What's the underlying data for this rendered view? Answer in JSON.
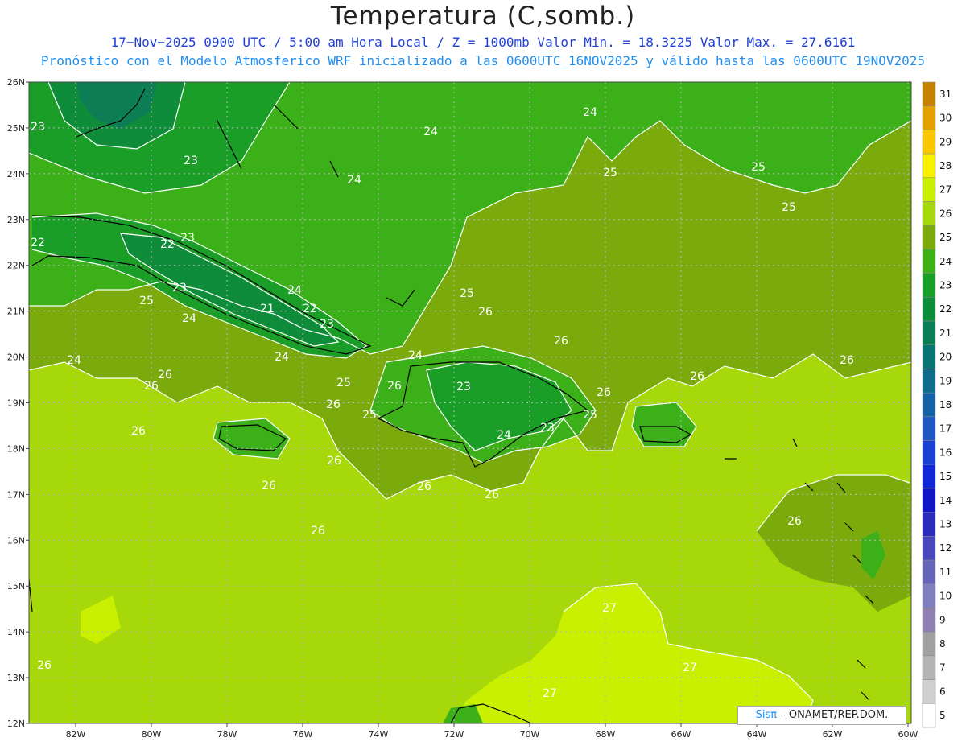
{
  "header": {
    "title": "Temperatura (C,somb.)",
    "line1": "17−Nov−2025  0900 UTC / 5:00 am Hora Local / Z = 1000mb   Valor Min. = 18.3225  Valor Max. = 27.6161",
    "line2": "Pronóstico con el Modelo Atmosferico WRF inicializado a las 0600UTC_16NOV2025 y válido hasta las  0600UTC_19NOV2025"
  },
  "axes": {
    "lat_labels": [
      "26N",
      "25N",
      "24N",
      "23N",
      "22N",
      "21N",
      "20N",
      "19N",
      "18N",
      "17N",
      "16N",
      "15N",
      "14N",
      "13N",
      "12N"
    ],
    "lon_labels": [
      "82W",
      "80W",
      "78W",
      "76W",
      "74W",
      "72W",
      "70W",
      "68W",
      "66W",
      "64W",
      "62W",
      "60W"
    ]
  },
  "colorbar": {
    "labels": [
      "31",
      "30",
      "29",
      "28",
      "27",
      "26",
      "25",
      "24",
      "23",
      "22",
      "21",
      "20",
      "19",
      "18",
      "17",
      "16",
      "15",
      "14",
      "13",
      "12",
      "11",
      "10",
      "9",
      "8",
      "7",
      "6",
      "5"
    ],
    "colors": [
      "#c58200",
      "#e3a000",
      "#fbc700",
      "#f9f000",
      "#c8f000",
      "#a6d80a",
      "#7aaa0c",
      "#3cb019",
      "#1a9e28",
      "#0f8c3a",
      "#0c7d55",
      "#0a7474",
      "#0f6c8c",
      "#1563a6",
      "#1f58c0",
      "#1840d2",
      "#1028d8",
      "#1015c8",
      "#2b2bbd",
      "#4848b8",
      "#6464b8",
      "#7f7fc0",
      "#8e80b0",
      "#a0a0a0",
      "#b4b4b4",
      "#cfcfcf",
      "#ffffff"
    ]
  },
  "contour_labels": [
    {
      "text": "23"
    },
    {
      "text": "23"
    },
    {
      "text": "24"
    },
    {
      "text": "24"
    },
    {
      "text": "24"
    },
    {
      "text": "25"
    },
    {
      "text": "25"
    },
    {
      "text": "25"
    },
    {
      "text": "22"
    },
    {
      "text": "22"
    },
    {
      "text": "23"
    },
    {
      "text": "23"
    },
    {
      "text": "24"
    },
    {
      "text": "21"
    },
    {
      "text": "22"
    },
    {
      "text": "23"
    },
    {
      "text": "25"
    },
    {
      "text": "24"
    },
    {
      "text": "24"
    },
    {
      "text": "26"
    },
    {
      "text": "26"
    },
    {
      "text": "25"
    },
    {
      "text": "26"
    },
    {
      "text": "26"
    },
    {
      "text": "26"
    },
    {
      "text": "25"
    },
    {
      "text": "24"
    },
    {
      "text": "25"
    },
    {
      "text": "26"
    },
    {
      "text": "26"
    },
    {
      "text": "26"
    },
    {
      "text": "23"
    },
    {
      "text": "24"
    },
    {
      "text": "23"
    },
    {
      "text": "25"
    },
    {
      "text": "26"
    },
    {
      "text": "26"
    },
    {
      "text": "26"
    },
    {
      "text": "26"
    },
    {
      "text": "26"
    },
    {
      "text": "26"
    },
    {
      "text": "26"
    },
    {
      "text": "27"
    },
    {
      "text": "27"
    },
    {
      "text": "27"
    },
    {
      "text": "26"
    },
    {
      "text": "26"
    },
    {
      "text": "24"
    }
  ],
  "credit": {
    "brand": "Sisπ",
    "text": "– ONAMET/REP.DOM."
  }
}
